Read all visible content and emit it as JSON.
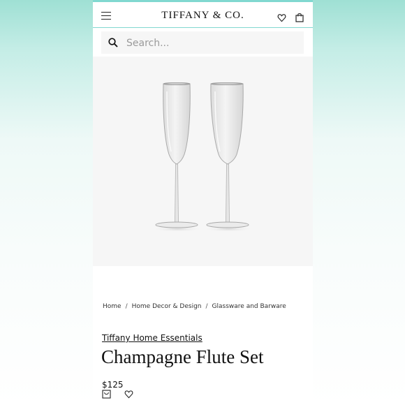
{
  "header": {
    "logo": "TIFFANY & CO.",
    "icons": [
      "menu-icon",
      "heart-icon",
      "shopping-bag-icon"
    ]
  },
  "search": {
    "placeholder": "Search..."
  },
  "product_image": {
    "alt": "Two crystal champagne flutes"
  },
  "breadcrumb": {
    "items": [
      "Home",
      "Home Decor & Design",
      "Glassware and Barware"
    ],
    "separator": "/"
  },
  "product": {
    "collection": "Tiffany Home Essentials",
    "title": "Champagne Flute Set",
    "price": "$125",
    "action_icons": [
      "engraving-bag-icon",
      "heart-icon"
    ]
  },
  "colors": {
    "accent": "#81d8d0",
    "text": "#111111",
    "image_bg": "#f6f6f6"
  }
}
